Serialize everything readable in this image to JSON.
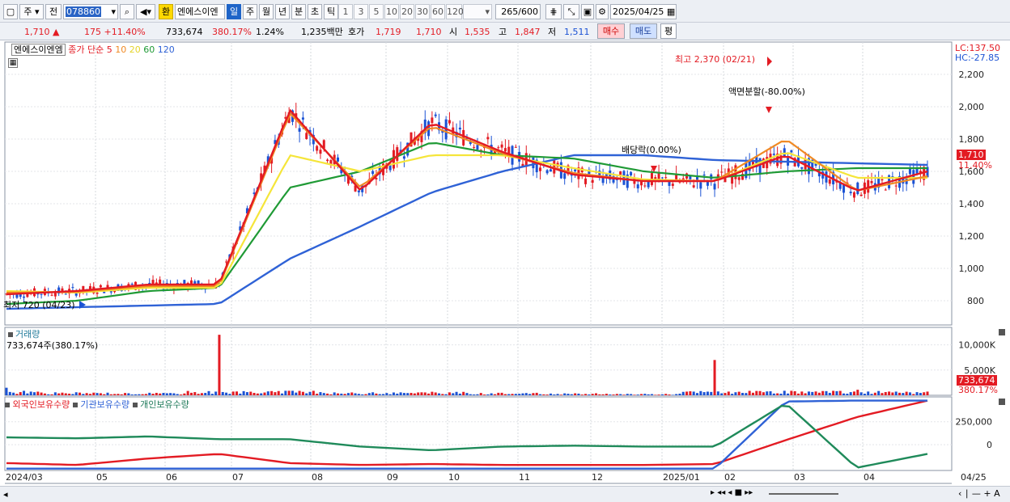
{
  "toolbar": {
    "mode_ju": "주",
    "mode_jeon": "전",
    "code": "078860",
    "hwan": "환",
    "name": "엔에스이엔",
    "periods": [
      "일",
      "주",
      "월",
      "년",
      "분",
      "초",
      "틱"
    ],
    "intervals": [
      "1",
      "3",
      "5",
      "10",
      "20",
      "30",
      "60",
      "120"
    ],
    "count": "265",
    "count_max": "/600",
    "date": "2025/04/25"
  },
  "quote": {
    "price": "1,710",
    "change": "175",
    "change_pct": "+11.40%",
    "volume": "733,674",
    "vol_ratio": "380.17%",
    "turnover": "1.24%",
    "amount": "1,235백만",
    "ask_label": "호가",
    "ask1": "1,719",
    "ask2": "1,710",
    "open_label": "시",
    "open": "1,535",
    "high_label": "고",
    "high": "1,847",
    "low_label": "저",
    "low": "1,511",
    "buy": "매수",
    "sell": "매도",
    "avg": "평"
  },
  "price_panel": {
    "legend_name": "엔에스이엔엠",
    "legend_ma": "종가 단순 5",
    "ma_periods": [
      "10",
      "20",
      "60",
      "120"
    ],
    "lc": "LC:137.50",
    "hc": "HC:-27.85",
    "last_price": "1,710",
    "last_pct": "11.40%",
    "y_ticks": [
      "2,200",
      "2,000",
      "1,800",
      "1,600",
      "1,400",
      "1,200",
      "1,000",
      "800"
    ],
    "annot_high": "최고 2,370 (02/21)",
    "annot_split": "액면분할(-80.00%)",
    "annot_div": "배당락(0.00%)",
    "annot_low": "최저 720 (04/23)"
  },
  "volume_panel": {
    "title": "거래량",
    "value": "733,674주(380.17%)",
    "y_ticks": [
      "10,000K",
      "5,000K"
    ],
    "last_value": "733,674",
    "last_pct": "380.17%"
  },
  "holdings_panel": {
    "series": [
      "외국인보유수량",
      "기관보유수량",
      "개인보유수량"
    ],
    "y_ticks": [
      "250,000",
      "0"
    ]
  },
  "x_axis": [
    "2024/03",
    "05",
    "06",
    "07",
    "08",
    "09",
    "10",
    "11",
    "12",
    "2025/01",
    "02",
    "03",
    "04",
    "04/25"
  ],
  "colors": {
    "ma5": "#e31b23",
    "ma10": "#f08a24",
    "ma20": "#f5e53a",
    "ma60": "#1f9a35",
    "ma120": "#2f62d6",
    "up": "#e31b23",
    "down": "#1b52d4"
  },
  "chart_data": [
    {
      "type": "line",
      "title": "",
      "x": [
        "2024/03",
        "05",
        "06",
        "07",
        "08",
        "09",
        "10",
        "11",
        "12",
        "2025/01",
        "02",
        "03",
        "04",
        "04/25"
      ],
      "series": [
        {
          "name": "5",
          "values": [
            840,
            860,
            900,
            900,
            1980,
            1480,
            1900,
            1720,
            1580,
            1540,
            1540,
            1700,
            1480,
            1600
          ]
        },
        {
          "name": "10",
          "values": [
            850,
            855,
            890,
            890,
            1960,
            1500,
            1880,
            1710,
            1590,
            1540,
            1540,
            1800,
            1480,
            1570
          ]
        },
        {
          "name": "20",
          "values": [
            860,
            850,
            880,
            880,
            1700,
            1600,
            1700,
            1700,
            1620,
            1550,
            1540,
            1720,
            1560,
            1560
          ]
        },
        {
          "name": "60",
          "values": [
            780,
            800,
            860,
            880,
            1500,
            1600,
            1780,
            1700,
            1680,
            1600,
            1560,
            1600,
            1620,
            1620
          ]
        },
        {
          "name": "120",
          "values": [
            750,
            760,
            770,
            780,
            1060,
            1260,
            1470,
            1600,
            1700,
            1700,
            1670,
            1660,
            1650,
            1640
          ]
        }
      ],
      "ylim": [
        650,
        2400
      ],
      "grid": true
    },
    {
      "type": "bar",
      "title": "",
      "x": [
        "2024/03",
        "05",
        "06",
        "07",
        "08",
        "09",
        "10",
        "11",
        "12",
        "2025/01",
        "02",
        "03",
        "04",
        "04/25"
      ],
      "series": [
        {
          "name": "거래량",
          "values": [
            1500000,
            600000,
            500000,
            12000000,
            900000,
            600000,
            700000,
            500000,
            400000,
            300000,
            7000000,
            900000,
            1100000,
            733674
          ]
        }
      ],
      "ylim": [
        0,
        12500000
      ]
    },
    {
      "type": "line",
      "title": "",
      "x": [
        "2024/03",
        "05",
        "06",
        "07",
        "08",
        "09",
        "10",
        "11",
        "12",
        "2025/01",
        "02",
        "03",
        "04",
        "04/25"
      ],
      "series": [
        {
          "name": "외국인보유수량",
          "values": [
            -200000,
            -220000,
            -150000,
            -100000,
            -200000,
            -220000,
            -210000,
            -220000,
            -220000,
            -220000,
            -210000,
            50000,
            300000,
            480000
          ]
        },
        {
          "name": "기관보유수량",
          "values": [
            -260000,
            -260000,
            -260000,
            -260000,
            -260000,
            -260000,
            -260000,
            -260000,
            -260000,
            -260000,
            -260000,
            470000,
            480000,
            480000
          ]
        },
        {
          "name": "개인보유수량",
          "values": [
            80000,
            70000,
            90000,
            60000,
            60000,
            -20000,
            -60000,
            -20000,
            -10000,
            -20000,
            -20000,
            450000,
            -250000,
            -100000
          ]
        }
      ],
      "ylim": [
        -280000,
        520000
      ]
    }
  ]
}
